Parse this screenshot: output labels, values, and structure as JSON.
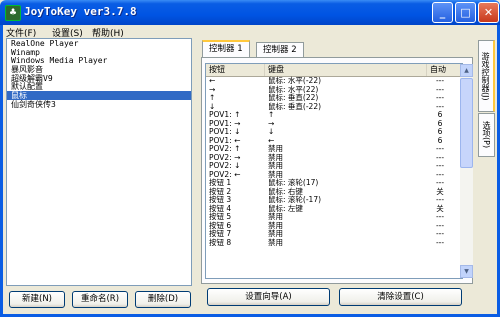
{
  "window": {
    "title": "JoyToKey ver3.7.8",
    "controls": {
      "minimize": "_",
      "maximize": "□",
      "close": "✕"
    }
  },
  "menu": [
    "文件(F)",
    "设置(S)",
    "帮助(H)"
  ],
  "profiles": {
    "items": [
      "RealOne Player",
      "Winamp",
      "Windows Media Player",
      "暴风影音",
      "超级解霸V9",
      "默认配置",
      "鼠标",
      "仙剑奇侠传3"
    ],
    "selected_index": 6
  },
  "profile_buttons": {
    "new": "新建(N)",
    "rename": "重命名(R)",
    "delete": "删除(D)"
  },
  "tabs": [
    "控制器 1",
    "控制器 2"
  ],
  "side_tabs": [
    "游戏控制器(J)",
    "选项(P)"
  ],
  "grid": {
    "headers": {
      "button": "按钮",
      "keyboard": "键盘",
      "auto": "自动"
    },
    "rows": [
      {
        "button": "←",
        "key": "鼠标: 水平(-22)",
        "auto": "---"
      },
      {
        "button": "→",
        "key": "鼠标: 水平(22)",
        "auto": "---"
      },
      {
        "button": "↑",
        "key": "鼠标: 垂直(22)",
        "auto": "---"
      },
      {
        "button": "↓",
        "key": "鼠标: 垂直(-22)",
        "auto": "---"
      },
      {
        "button": "POV1: ↑",
        "key": "↑",
        "auto": "6"
      },
      {
        "button": "POV1: →",
        "key": "→",
        "auto": "6"
      },
      {
        "button": "POV1: ↓",
        "key": "↓",
        "auto": "6"
      },
      {
        "button": "POV1: ←",
        "key": "←",
        "auto": "6"
      },
      {
        "button": "POV2: ↑",
        "key": "禁用",
        "auto": "---"
      },
      {
        "button": "POV2: →",
        "key": "禁用",
        "auto": "---"
      },
      {
        "button": "POV2: ↓",
        "key": "禁用",
        "auto": "---"
      },
      {
        "button": "POV2: ←",
        "key": "禁用",
        "auto": "---"
      },
      {
        "button": "按钮 1",
        "key": "鼠标: 滚轮(17)",
        "auto": "---"
      },
      {
        "button": "按钮 2",
        "key": "鼠标: 右键",
        "auto": "关"
      },
      {
        "button": "按钮 3",
        "key": "鼠标: 滚轮(-17)",
        "auto": "---"
      },
      {
        "button": "按钮 4",
        "key": "鼠标: 左键",
        "auto": "关"
      },
      {
        "button": "按钮 5",
        "key": "禁用",
        "auto": "---"
      },
      {
        "button": "按钮 6",
        "key": "禁用",
        "auto": "---"
      },
      {
        "button": "按钮 7",
        "key": "禁用",
        "auto": "---"
      },
      {
        "button": "按钮 8",
        "key": "禁用",
        "auto": "---"
      }
    ]
  },
  "bottom_buttons": {
    "wizard": "设置向导(A)",
    "clear": "清除设置(C)"
  },
  "colors": {
    "titlebar": "#0054E3",
    "selection": "#316AC5",
    "tab_highlight": "#FFC83C"
  }
}
